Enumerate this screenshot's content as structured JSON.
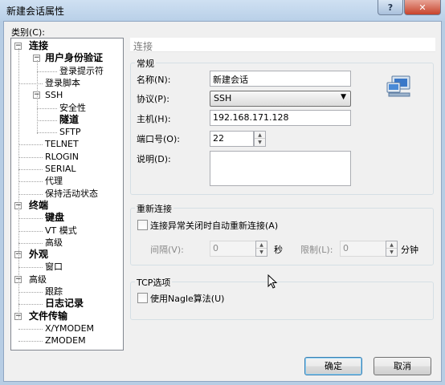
{
  "window": {
    "title": "新建会话属性",
    "help_glyph": "?",
    "close_glyph": "✕"
  },
  "category_label": "类别(C):",
  "tree": [
    {
      "label": "连接",
      "bold": true,
      "level": 0,
      "toggle": "−"
    },
    {
      "label": "用户身份验证",
      "bold": true,
      "level": 1,
      "toggle": "−"
    },
    {
      "label": "登录提示符",
      "bold": false,
      "level": 2
    },
    {
      "label": "登录脚本",
      "bold": false,
      "level": 1
    },
    {
      "label": "SSH",
      "bold": false,
      "level": 1,
      "toggle": "−"
    },
    {
      "label": "安全性",
      "bold": false,
      "level": 2
    },
    {
      "label": "隧道",
      "bold": true,
      "level": 2
    },
    {
      "label": "SFTP",
      "bold": false,
      "level": 2
    },
    {
      "label": "TELNET",
      "bold": false,
      "level": 1
    },
    {
      "label": "RLOGIN",
      "bold": false,
      "level": 1
    },
    {
      "label": "SERIAL",
      "bold": false,
      "level": 1
    },
    {
      "label": "代理",
      "bold": false,
      "level": 1
    },
    {
      "label": "保持活动状态",
      "bold": false,
      "level": 1
    },
    {
      "label": "终端",
      "bold": true,
      "level": 0,
      "toggle": "−"
    },
    {
      "label": "键盘",
      "bold": true,
      "level": 1
    },
    {
      "label": "VT 模式",
      "bold": false,
      "level": 1
    },
    {
      "label": "高级",
      "bold": false,
      "level": 1
    },
    {
      "label": "外观",
      "bold": true,
      "level": 0,
      "toggle": "−"
    },
    {
      "label": "窗口",
      "bold": false,
      "level": 1
    },
    {
      "label": "高级",
      "bold": false,
      "level": 0,
      "toggle": "−"
    },
    {
      "label": "跟踪",
      "bold": false,
      "level": 1
    },
    {
      "label": "日志记录",
      "bold": true,
      "level": 1
    },
    {
      "label": "文件传输",
      "bold": true,
      "level": 0,
      "toggle": "−"
    },
    {
      "label": "X/YMODEM",
      "bold": false,
      "level": 1
    },
    {
      "label": "ZMODEM",
      "bold": false,
      "level": 1
    }
  ],
  "panel": {
    "header": "连接",
    "general": {
      "title": "常规",
      "name_label": "名称(N):",
      "name_value": "新建会话",
      "protocol_label": "协议(P):",
      "protocol_value": "SSH",
      "host_label": "主机(H):",
      "host_value": "192.168.171.128",
      "port_label": "端口号(O):",
      "port_value": "22",
      "desc_label": "说明(D):",
      "desc_value": ""
    },
    "reconnect": {
      "title": "重新连接",
      "auto_label": "连接异常关闭时自动重新连接(A)",
      "interval_label": "间隔(V):",
      "interval_value": "0",
      "seconds_unit": "秒",
      "limit_label": "限制(L):",
      "limit_value": "0",
      "minutes_unit": "分钟"
    },
    "tcp": {
      "title": "TCP选项",
      "nagle_label": "使用Nagle算法(U)"
    }
  },
  "buttons": {
    "ok": "确定",
    "cancel": "取消"
  },
  "colors": {
    "accent": "#3c7fb1",
    "titlebar": "#b9d0e8",
    "close": "#c7432c"
  }
}
